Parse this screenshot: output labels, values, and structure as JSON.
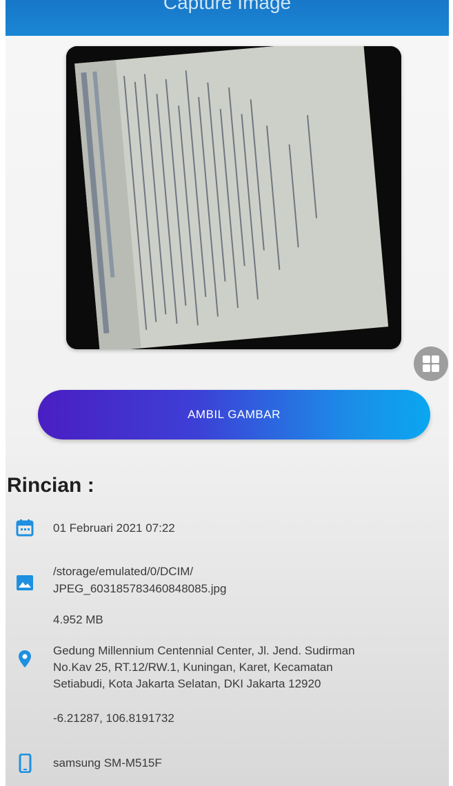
{
  "app_bar": {
    "title": "Capture Image"
  },
  "actions": {
    "capture_label": "AMBIL GAMBAR"
  },
  "details": {
    "heading": "Rincian :",
    "date": "01 Februari 2021 07:22",
    "path_line1": "/storage/emulated/0/DCIM/",
    "path_line2": "JPEG_603185783460848085.jpg",
    "size": "4.952 MB",
    "address_line1": "Gedung Millennium Centennial Center, Jl. Jend. Sudirman",
    "address_line2": "No.Kav 25, RT.12/RW.1, Kuningan, Karet, Kecamatan",
    "address_line3": "Setiabudi, Kota Jakarta Selatan, DKI Jakarta 12920",
    "coordinates": "-6.21287, 106.8191732",
    "device": "samsung SM-M515F"
  },
  "icons": {
    "date": "calendar-icon",
    "path": "image-icon",
    "address": "location-pin-icon",
    "device": "phone-icon",
    "fab": "grid-icon"
  },
  "colors": {
    "app_bar": "#1a86d4",
    "icon_accent": "#1e90e0",
    "button_start": "#4a1ec2",
    "button_end": "#0aa7f0"
  }
}
